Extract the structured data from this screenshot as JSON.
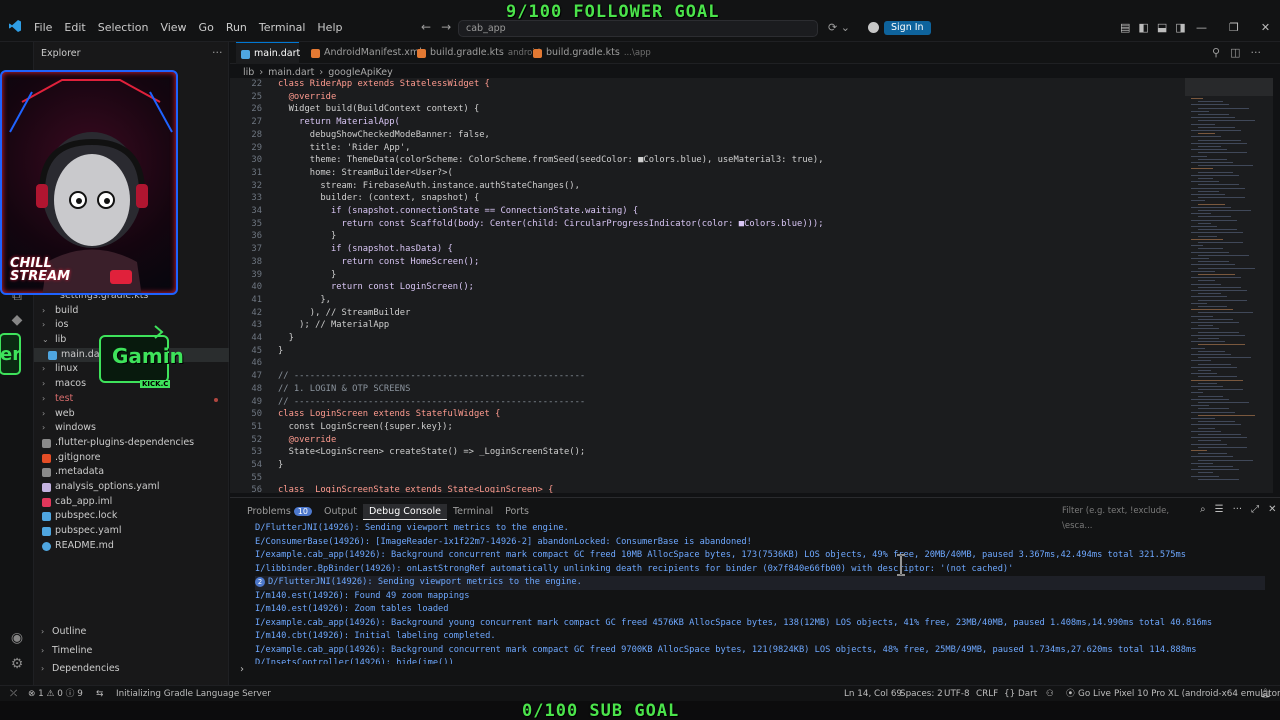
{
  "overlays": {
    "follower_goal": "9/100 FOLLOWER GOAL",
    "sub_goal": "0/100 SUB GOAL"
  },
  "titlebar": {
    "menu": [
      "File",
      "Edit",
      "Selection",
      "View",
      "Go",
      "Run",
      "Terminal",
      "Help"
    ],
    "search_label": "cab_app",
    "signin": "Sign In"
  },
  "sidebar": {
    "title": "Explorer",
    "tree": [
      {
        "label": "settings.gradle.kts",
        "kind": "file"
      },
      {
        "label": "build",
        "kind": "folder"
      },
      {
        "label": "ios",
        "kind": "folder"
      },
      {
        "label": "lib",
        "kind": "folder-open"
      },
      {
        "label": "main.dart",
        "kind": "file"
      },
      {
        "label": "linux",
        "kind": "folder"
      },
      {
        "label": "macos",
        "kind": "folder"
      },
      {
        "label": "test",
        "kind": "folder"
      },
      {
        "label": "web",
        "kind": "folder"
      },
      {
        "label": "windows",
        "kind": "folder"
      },
      {
        "label": ".flutter-plugins-dependencies",
        "kind": "file"
      },
      {
        "label": ".gitignore",
        "kind": "file"
      },
      {
        "label": ".metadata",
        "kind": "file"
      },
      {
        "label": "analysis_options.yaml",
        "kind": "file"
      },
      {
        "label": "cab_app.iml",
        "kind": "file"
      },
      {
        "label": "pubspec.lock",
        "kind": "file"
      },
      {
        "label": "pubspec.yaml",
        "kind": "file"
      },
      {
        "label": "README.md",
        "kind": "file"
      }
    ],
    "sections": [
      "Outline",
      "Timeline",
      "Dependencies"
    ]
  },
  "webcam": {
    "caption": "CHILL STREAM",
    "badge": "Gamin",
    "badge_left": "er",
    "badge_sub": "KICK.C"
  },
  "tabs": [
    {
      "label": "main.dart",
      "sub": "",
      "color": "#4fa6e0"
    },
    {
      "label": "AndroidManifest.xml",
      "sub": "",
      "color": "#e37933"
    },
    {
      "label": "build.gradle.kts",
      "sub": "android",
      "color": "#e37933"
    },
    {
      "label": "build.gradle.kts",
      "sub": "...\\app",
      "color": "#e37933"
    }
  ],
  "breadcrumb": [
    "lib",
    "main.dart",
    "googleApiKey"
  ],
  "code": {
    "lines": [
      {
        "n": "22",
        "t": "class RiderApp extends StatelessWidget {"
      },
      {
        "n": "25",
        "t": "  @override"
      },
      {
        "n": "26",
        "t": "  Widget build(BuildContext context) {"
      },
      {
        "n": "27",
        "t": "    return MaterialApp("
      },
      {
        "n": "28",
        "t": "      debugShowCheckedModeBanner: false,"
      },
      {
        "n": "29",
        "t": "      title: 'Rider App',"
      },
      {
        "n": "30",
        "t": "      theme: ThemeData(colorScheme: ColorScheme.fromSeed(seedColor: ■Colors.blue), useMaterial3: true),"
      },
      {
        "n": "31",
        "t": "      home: StreamBuilder<User?>("
      },
      {
        "n": "32",
        "t": "        stream: FirebaseAuth.instance.authStateChanges(),"
      },
      {
        "n": "33",
        "t": "        builder: (context, snapshot) {"
      },
      {
        "n": "34",
        "t": "          if (snapshot.connectionState == ConnectionState.waiting) {"
      },
      {
        "n": "35",
        "t": "            return const Scaffold(body: Center(child: CircularProgressIndicator(color: ■Colors.blue)));"
      },
      {
        "n": "36",
        "t": "          }"
      },
      {
        "n": "37",
        "t": "          if (snapshot.hasData) {"
      },
      {
        "n": "38",
        "t": "            return const HomeScreen();"
      },
      {
        "n": "39",
        "t": "          }"
      },
      {
        "n": "40",
        "t": "          return const LoginScreen();"
      },
      {
        "n": "41",
        "t": "        },"
      },
      {
        "n": "42",
        "t": "      ), // StreamBuilder"
      },
      {
        "n": "43",
        "t": "    ); // MaterialApp"
      },
      {
        "n": "44",
        "t": "  }"
      },
      {
        "n": "45",
        "t": "}"
      },
      {
        "n": "46",
        "t": ""
      },
      {
        "n": "47",
        "t": "// -------------------------------------------------------"
      },
      {
        "n": "48",
        "t": "// 1. LOGIN & OTP SCREENS"
      },
      {
        "n": "49",
        "t": "// -------------------------------------------------------"
      },
      {
        "n": "50",
        "t": "class LoginScreen extends StatefulWidget {"
      },
      {
        "n": "51",
        "t": "  const LoginScreen({super.key});"
      },
      {
        "n": "52",
        "t": "  @override"
      },
      {
        "n": "53",
        "t": "  State<LoginScreen> createState() => _LoginScreenState();"
      },
      {
        "n": "54",
        "t": "}"
      },
      {
        "n": "55",
        "t": ""
      },
      {
        "n": "56",
        "t": "class _LoginScreenState extends State<LoginScreen> {"
      }
    ]
  },
  "panel": {
    "tabs": [
      {
        "label": "Problems",
        "badge": "10"
      },
      {
        "label": "Output",
        "badge": ""
      },
      {
        "label": "Debug Console",
        "badge": ""
      },
      {
        "label": "Terminal",
        "badge": ""
      },
      {
        "label": "Ports",
        "badge": ""
      }
    ],
    "filter_placeholder": "Filter (e.g. text, !exclude, \\esca...",
    "console": [
      {
        "t": "D/FlutterJNI(14926): Sending viewport metrics to the engine.",
        "rep": ""
      },
      {
        "t": "E/ConsumerBase(14926): [ImageReader-1x1f22m7-14926-2] abandonLocked: ConsumerBase is abandoned!",
        "rep": ""
      },
      {
        "t": "I/example.cab_app(14926): Background concurrent mark compact GC freed 10MB AllocSpace bytes, 173(7536KB) LOS objects, 49% free, 20MB/40MB, paused 3.367ms,42.494ms total 321.575ms",
        "rep": ""
      },
      {
        "t": "I/libbinder.BpBinder(14926): onLastStrongRef automatically unlinking death recipients for binder (0x7f840e66fb00) with descriptor: '(not cached)'",
        "rep": ""
      },
      {
        "t": "D/FlutterJNI(14926): Sending viewport metrics to the engine.",
        "rep": "2"
      },
      {
        "t": "I/m140.est(14926): Found 49 zoom mappings",
        "rep": ""
      },
      {
        "t": "I/m140.est(14926): Zoom tables loaded",
        "rep": ""
      },
      {
        "t": "I/example.cab_app(14926): Background young concurrent mark compact GC freed 4576KB AllocSpace bytes, 138(12MB) LOS objects, 41% free, 23MB/40MB, paused 1.408ms,14.990ms total 40.816ms",
        "rep": ""
      },
      {
        "t": "I/m140.cbt(14926): Initial labeling completed.",
        "rep": ""
      },
      {
        "t": "I/example.cab_app(14926): Background concurrent mark compact GC freed 9700KB AllocSpace bytes, 121(9824KB) LOS objects, 48% free, 25MB/49MB, paused 1.734ms,27.620ms total 114.888ms",
        "rep": ""
      },
      {
        "t": "D/InsetsController(14926): hide(ime())",
        "rep": ""
      }
    ]
  },
  "statusbar": {
    "remote": "⤫",
    "problems": "⊗ 1 ⚠ 0 ⓘ 9",
    "task": "Initializing Gradle Language Server",
    "position": "Ln 14, Col 69",
    "spaces": "Spaces: 2",
    "encoding": "UTF-8",
    "eol": "CRLF",
    "language": "Dart",
    "golive": "Go Live",
    "device": "Pixel 10 Pro XL (android-x64 emulator)"
  }
}
